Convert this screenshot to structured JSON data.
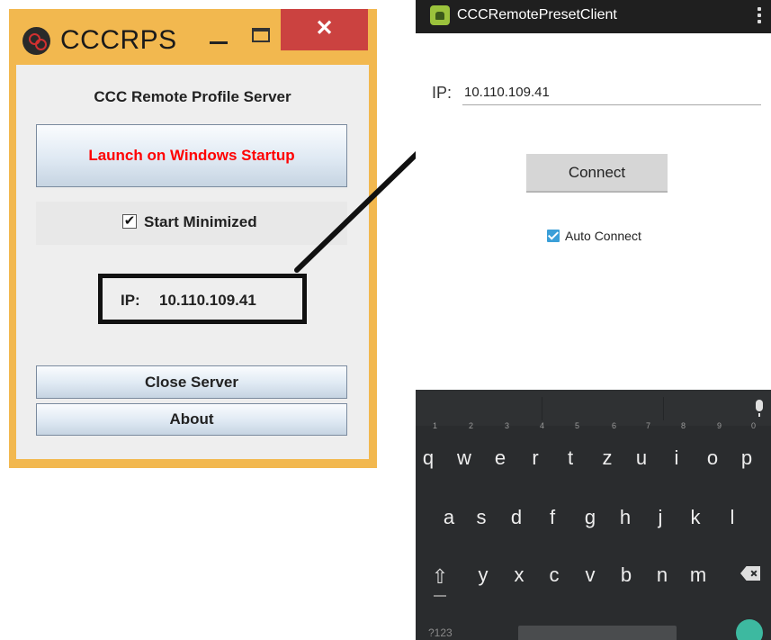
{
  "windows_app": {
    "title": "CCCRPS",
    "close_glyph": "✕",
    "heading": "CCC Remote Profile Server",
    "launch_button": "Launch on Windows Startup",
    "start_minimized_label": "Start Minimized",
    "start_minimized_checked": true,
    "checkbox_glyph": "✔",
    "ip_label": "IP:",
    "ip_value": "10.110.109.41",
    "close_server_button": "Close Server",
    "about_button": "About",
    "colors": {
      "frame": "#f2b84f",
      "close": "#cb4240",
      "launch_text": "#ff0000"
    }
  },
  "android_app": {
    "title": "CCCRemotePresetClient",
    "ip_label": "IP:",
    "ip_input_value": "10.110.109.41",
    "connect_button": "Connect",
    "auto_connect_label": "Auto Connect",
    "auto_connect_checked": true,
    "colors": {
      "action_bar": "#1f1f1f",
      "checkbox": "#3b9fd8",
      "keyboard": "#2a2c2e",
      "enter": "#3db9a0"
    }
  },
  "keyboard": {
    "row1": [
      {
        "label": "q",
        "hint": "1"
      },
      {
        "label": "w",
        "hint": "2"
      },
      {
        "label": "e",
        "hint": "3"
      },
      {
        "label": "r",
        "hint": "4"
      },
      {
        "label": "t",
        "hint": "5"
      },
      {
        "label": "z",
        "hint": "6"
      },
      {
        "label": "u",
        "hint": "7"
      },
      {
        "label": "i",
        "hint": "8"
      },
      {
        "label": "o",
        "hint": "9"
      },
      {
        "label": "p",
        "hint": "0"
      }
    ],
    "row2": [
      "a",
      "s",
      "d",
      "f",
      "g",
      "h",
      "j",
      "k",
      "l"
    ],
    "row3": [
      "y",
      "x",
      "c",
      "v",
      "b",
      "n",
      "m"
    ],
    "shift_glyph": "⇧",
    "symbols_label": "?123",
    "mic_icon": "mic-icon",
    "backspace_icon": "backspace-icon",
    "enter_icon": "enter-icon"
  }
}
